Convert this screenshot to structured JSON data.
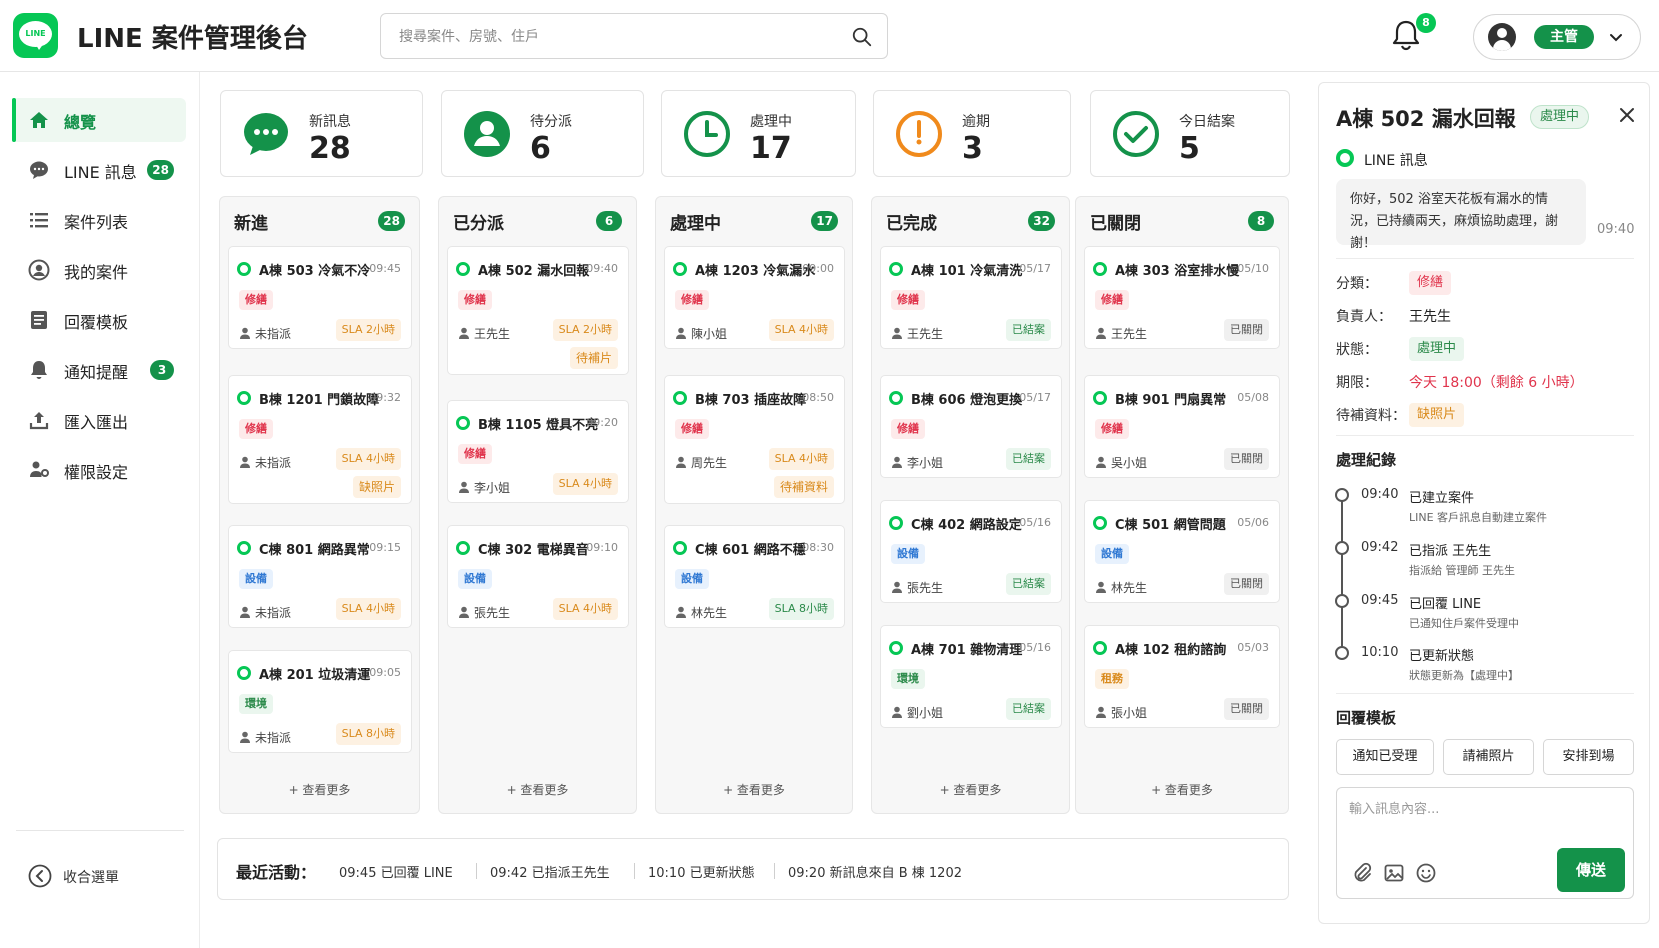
{
  "app": {
    "title": "LINE 案件管理後台",
    "logo_text": "LINE"
  },
  "search": {
    "placeholder": "搜尋案件、房號、住戶"
  },
  "header": {
    "notification_count": "8",
    "user_role": "主管"
  },
  "sidebar": {
    "items": [
      {
        "label": "總覽",
        "icon": "home-icon",
        "active": true
      },
      {
        "label": "LINE 訊息",
        "icon": "chat-icon",
        "badge": "28"
      },
      {
        "label": "案件列表",
        "icon": "list-icon"
      },
      {
        "label": "我的案件",
        "icon": "user-icon"
      },
      {
        "label": "回覆模板",
        "icon": "template-icon"
      },
      {
        "label": "通知提醒",
        "icon": "bell-icon",
        "badge": "3"
      },
      {
        "label": "匯入匯出",
        "icon": "upload-icon"
      },
      {
        "label": "權限設定",
        "icon": "permission-icon"
      }
    ],
    "collapse_label": "收合選單"
  },
  "stats": [
    {
      "label": "新訊息",
      "value": "28",
      "icon": "chat-bubble-icon"
    },
    {
      "label": "待分派",
      "value": "6",
      "icon": "person-icon"
    },
    {
      "label": "處理中",
      "value": "17",
      "icon": "clock-icon"
    },
    {
      "label": "逾期",
      "value": "3",
      "icon": "alarm-icon"
    },
    {
      "label": "今日結案",
      "value": "5",
      "icon": "check-circle-icon"
    }
  ],
  "columns": [
    {
      "title": "新進",
      "count": "28",
      "see_more": "+ 查看更多",
      "cards": [
        {
          "title": "A棟 503 冷氣不冷",
          "time": "09:45",
          "tag": "修繕",
          "tag_type": "repair",
          "person": "未指派",
          "sla": "SLA 2小時",
          "sla_type": "orange"
        },
        {
          "title": "B棟 1201 門鎖故障",
          "time": "09:32",
          "tag": "修繕",
          "tag_type": "repair",
          "person": "未指派",
          "sla": "SLA 4小時",
          "sla_type": "orange",
          "extra": "缺照片"
        },
        {
          "title": "C棟 801 網路異常",
          "time": "09:15",
          "tag": "設備",
          "tag_type": "equip",
          "person": "未指派",
          "sla": "SLA 4小時",
          "sla_type": "orange"
        },
        {
          "title": "A棟 201 垃圾清運",
          "time": "09:05",
          "tag": "環境",
          "tag_type": "env",
          "person": "未指派",
          "sla": "SLA 8小時",
          "sla_type": "orange"
        }
      ]
    },
    {
      "title": "已分派",
      "count": "6",
      "see_more": "+ 查看更多",
      "cards": [
        {
          "title": "A棟 502 漏水回報",
          "time": "09:40",
          "tag": "修繕",
          "tag_type": "repair",
          "person": "王先生",
          "sla": "SLA 2小時",
          "sla_type": "orange",
          "extra": "待補片"
        },
        {
          "title": "B棟 1105 燈具不亮",
          "time": "09:20",
          "tag": "修繕",
          "tag_type": "repair",
          "person": "李小姐",
          "sla": "SLA 4小時",
          "sla_type": "orange"
        },
        {
          "title": "C棟 302 電梯異音",
          "time": "09:10",
          "tag": "設備",
          "tag_type": "equip",
          "person": "張先生",
          "sla": "SLA 4小時",
          "sla_type": "orange"
        }
      ]
    },
    {
      "title": "處理中",
      "count": "17",
      "see_more": "+ 查看更多",
      "cards": [
        {
          "title": "A棟 1203 冷氣漏水",
          "time": "09:00",
          "tag": "修繕",
          "tag_type": "repair",
          "person": "陳小姐",
          "sla": "SLA 4小時",
          "sla_type": "orange"
        },
        {
          "title": "B棟 703 插座故障",
          "time": "08:50",
          "tag": "修繕",
          "tag_type": "repair",
          "person": "周先生",
          "sla": "SLA 4小時",
          "sla_type": "orange",
          "extra": "待補資料"
        },
        {
          "title": "C棟 601 網路不穩",
          "time": "08:30",
          "tag": "設備",
          "tag_type": "equip",
          "person": "林先生",
          "sla": "SLA 8小時",
          "sla_type": "green"
        }
      ]
    },
    {
      "title": "已完成",
      "count": "32",
      "see_more": "+ 查看更多",
      "cards": [
        {
          "title": "A棟 101 冷氣清洗",
          "time": "05/17",
          "tag": "修繕",
          "tag_type": "repair",
          "person": "王先生",
          "sla": "已結案",
          "sla_type": "green"
        },
        {
          "title": "B棟 606 燈泡更換",
          "time": "05/17",
          "tag": "修繕",
          "tag_type": "repair",
          "person": "李小姐",
          "sla": "已結案",
          "sla_type": "green"
        },
        {
          "title": "C棟 402 網路設定",
          "time": "05/16",
          "tag": "設備",
          "tag_type": "equip",
          "person": "張先生",
          "sla": "已結案",
          "sla_type": "green"
        },
        {
          "title": "A棟 701 雜物清理",
          "time": "05/16",
          "tag": "環境",
          "tag_type": "env",
          "person": "劉小姐",
          "sla": "已結案",
          "sla_type": "green"
        }
      ]
    },
    {
      "title": "已關閉",
      "count": "8",
      "see_more": "+ 查看更多",
      "cards": [
        {
          "title": "A棟 303 浴室排水慢",
          "time": "05/10",
          "tag": "修繕",
          "tag_type": "repair",
          "person": "王先生",
          "sla": "已關閉",
          "sla_type": "grey"
        },
        {
          "title": "B棟 901 門扇異常",
          "time": "05/08",
          "tag": "修繕",
          "tag_type": "repair",
          "person": "吳小姐",
          "sla": "已關閉",
          "sla_type": "grey"
        },
        {
          "title": "C棟 501 網管問題",
          "time": "05/06",
          "tag": "設備",
          "tag_type": "equip",
          "person": "林先生",
          "sla": "已關閉",
          "sla_type": "grey"
        },
        {
          "title": "A棟 102 租約諮詢",
          "time": "05/03",
          "tag": "租務",
          "tag_type": "lease",
          "person": "張小姐",
          "sla": "已關閉",
          "sla_type": "grey"
        }
      ]
    }
  ],
  "activity": {
    "label": "最近活動：",
    "items": [
      "09:45  已回覆 LINE",
      "09:42  已指派王先生",
      "10:10  已更新狀態",
      "09:20  新訊息來自 B 棟 1202"
    ]
  },
  "detail": {
    "title": "A棟 502 漏水回報",
    "status_badge": "處理中",
    "source": "LINE 訊息",
    "message": "你好，502 浴室天花板有漏水的情況，已持續兩天，麻煩協助處理，謝謝！",
    "message_time": "09:40",
    "fields": {
      "category_label": "分類：",
      "category": "修繕",
      "assignee_label": "負責人：",
      "assignee": "王先生",
      "status_label": "狀態：",
      "status": "處理中",
      "deadline_label": "期限：",
      "deadline": "今天 18:00（剩餘 6 小時）",
      "pending_label": "待補資料：",
      "pending": "缺照片"
    },
    "timeline_title": "處理紀錄",
    "timeline": [
      {
        "time": "09:40",
        "title": "已建立案件",
        "sub": "LINE 客戶訊息自動建立案件"
      },
      {
        "time": "09:42",
        "title": "已指派 王先生",
        "sub": "指派給 管理師 王先生"
      },
      {
        "time": "09:45",
        "title": "已回覆 LINE",
        "sub": "已通知住戶案件受理中"
      },
      {
        "time": "10:10",
        "title": "已更新狀態",
        "sub": "狀態更新為【處理中】"
      }
    ],
    "templates_title": "回覆模板",
    "templates": [
      "通知已受理",
      "請補照片",
      "安排到場"
    ],
    "composer_placeholder": "輸入訊息內容...",
    "send_label": "傳送"
  },
  "colors": {
    "brand": "#06c755",
    "brand_dark": "#14924a",
    "overdue": "#f08a1c",
    "danger": "#e0344c"
  }
}
